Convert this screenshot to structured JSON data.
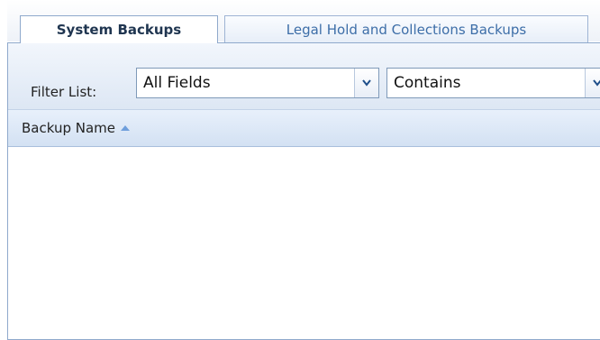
{
  "tabs": [
    {
      "label": "System Backups",
      "active": true
    },
    {
      "label": "Legal Hold and Collections Backups",
      "active": false
    }
  ],
  "filter": {
    "label": "Filter List:",
    "field_value": "All Fields",
    "operator_value": "Contains"
  },
  "grid": {
    "columns": [
      {
        "label": "Backup Name",
        "sort": "ascending"
      }
    ],
    "rows": []
  },
  "icons": {
    "dropdown": "chevron-down-icon",
    "sort": "sort-ascending-icon"
  },
  "colors": {
    "border": "#8fa9cc",
    "header_bg": "#dde7f4",
    "link_tab_text": "#3d6ea8",
    "active_tab_text": "#1f3550"
  }
}
